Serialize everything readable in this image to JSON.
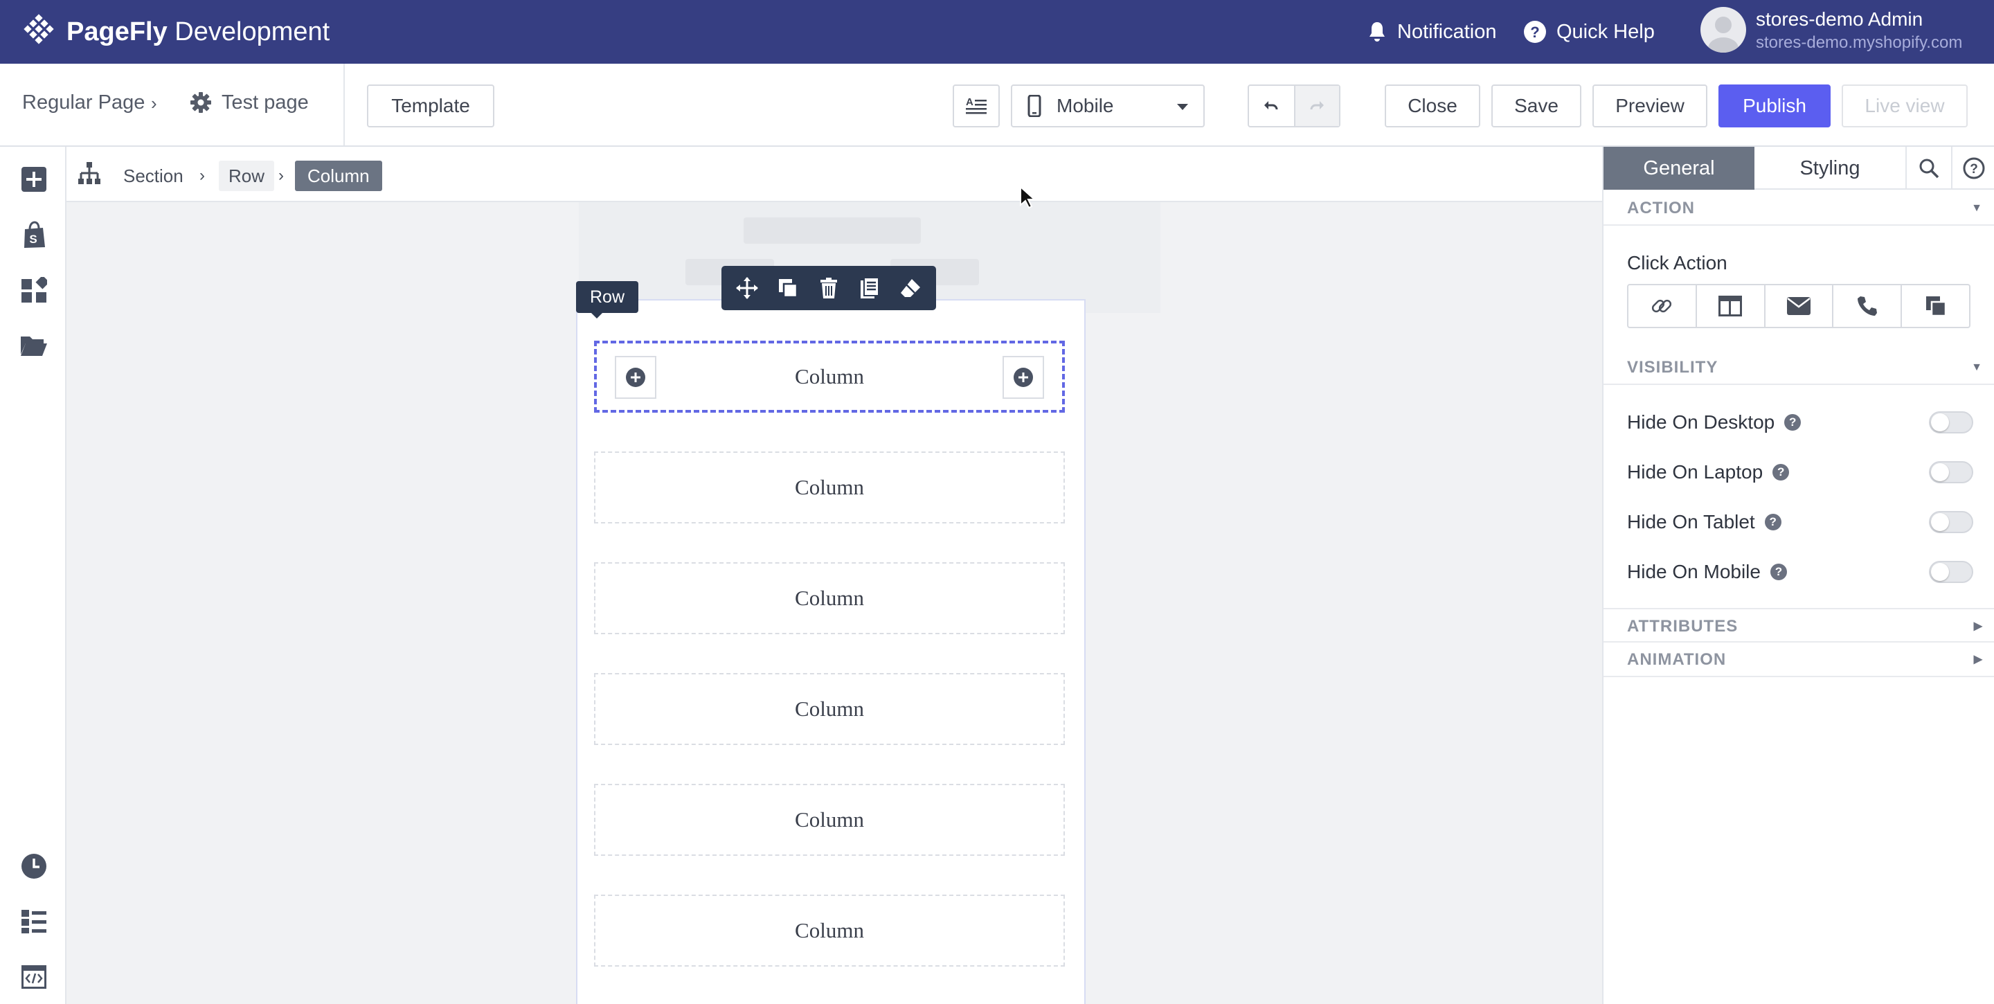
{
  "app": {
    "brand_bold": "PageFly",
    "brand_rest": " Development"
  },
  "topbar": {
    "notification": "Notification",
    "quick_help": "Quick Help",
    "user_name": "stores-demo Admin",
    "user_store": "stores-demo.myshopify.com"
  },
  "toolbar": {
    "page_type": "Regular Page",
    "page_name": "Test page",
    "template": "Template",
    "device": "Mobile",
    "close": "Close",
    "save": "Save",
    "preview": "Preview",
    "publish": "Publish",
    "live_view": "Live view"
  },
  "element_breadcrumb": [
    "Section",
    "Row",
    "Column"
  ],
  "canvas": {
    "row_tag": "Row",
    "columns": [
      "Column",
      "Column",
      "Column",
      "Column",
      "Column",
      "Column"
    ]
  },
  "panel": {
    "tabs": [
      "General",
      "Styling"
    ],
    "action_header": "ACTION",
    "click_action_label": "Click Action",
    "visibility_header": "VISIBILITY",
    "visibility": [
      {
        "label": "Hide On Desktop",
        "on": false
      },
      {
        "label": "Hide On Laptop",
        "on": false
      },
      {
        "label": "Hide On Tablet",
        "on": false
      },
      {
        "label": "Hide On Mobile",
        "on": false
      }
    ],
    "attributes_header": "ATTRIBUTES",
    "animation_header": "ANIMATION"
  },
  "colors": {
    "topbar": "#363e82",
    "primary": "#5b5ef0",
    "selection": "#6268e4",
    "dark_ui": "#2c3950"
  }
}
